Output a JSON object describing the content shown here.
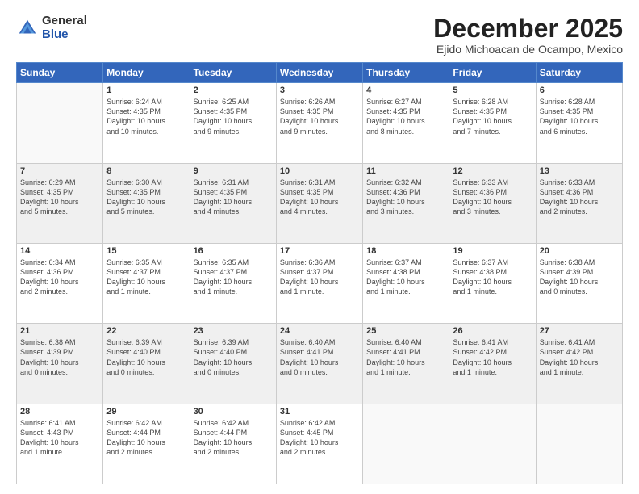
{
  "logo": {
    "general": "General",
    "blue": "Blue"
  },
  "title": "December 2025",
  "location": "Ejido Michoacan de Ocampo, Mexico",
  "weekdays": [
    "Sunday",
    "Monday",
    "Tuesday",
    "Wednesday",
    "Thursday",
    "Friday",
    "Saturday"
  ],
  "weeks": [
    [
      {
        "day": "",
        "info": ""
      },
      {
        "day": "1",
        "info": "Sunrise: 6:24 AM\nSunset: 4:35 PM\nDaylight: 10 hours\nand 10 minutes."
      },
      {
        "day": "2",
        "info": "Sunrise: 6:25 AM\nSunset: 4:35 PM\nDaylight: 10 hours\nand 9 minutes."
      },
      {
        "day": "3",
        "info": "Sunrise: 6:26 AM\nSunset: 4:35 PM\nDaylight: 10 hours\nand 9 minutes."
      },
      {
        "day": "4",
        "info": "Sunrise: 6:27 AM\nSunset: 4:35 PM\nDaylight: 10 hours\nand 8 minutes."
      },
      {
        "day": "5",
        "info": "Sunrise: 6:28 AM\nSunset: 4:35 PM\nDaylight: 10 hours\nand 7 minutes."
      },
      {
        "day": "6",
        "info": "Sunrise: 6:28 AM\nSunset: 4:35 PM\nDaylight: 10 hours\nand 6 minutes."
      }
    ],
    [
      {
        "day": "7",
        "info": "Sunrise: 6:29 AM\nSunset: 4:35 PM\nDaylight: 10 hours\nand 5 minutes."
      },
      {
        "day": "8",
        "info": "Sunrise: 6:30 AM\nSunset: 4:35 PM\nDaylight: 10 hours\nand 5 minutes."
      },
      {
        "day": "9",
        "info": "Sunrise: 6:31 AM\nSunset: 4:35 PM\nDaylight: 10 hours\nand 4 minutes."
      },
      {
        "day": "10",
        "info": "Sunrise: 6:31 AM\nSunset: 4:35 PM\nDaylight: 10 hours\nand 4 minutes."
      },
      {
        "day": "11",
        "info": "Sunrise: 6:32 AM\nSunset: 4:36 PM\nDaylight: 10 hours\nand 3 minutes."
      },
      {
        "day": "12",
        "info": "Sunrise: 6:33 AM\nSunset: 4:36 PM\nDaylight: 10 hours\nand 3 minutes."
      },
      {
        "day": "13",
        "info": "Sunrise: 6:33 AM\nSunset: 4:36 PM\nDaylight: 10 hours\nand 2 minutes."
      }
    ],
    [
      {
        "day": "14",
        "info": "Sunrise: 6:34 AM\nSunset: 4:36 PM\nDaylight: 10 hours\nand 2 minutes."
      },
      {
        "day": "15",
        "info": "Sunrise: 6:35 AM\nSunset: 4:37 PM\nDaylight: 10 hours\nand 1 minute."
      },
      {
        "day": "16",
        "info": "Sunrise: 6:35 AM\nSunset: 4:37 PM\nDaylight: 10 hours\nand 1 minute."
      },
      {
        "day": "17",
        "info": "Sunrise: 6:36 AM\nSunset: 4:37 PM\nDaylight: 10 hours\nand 1 minute."
      },
      {
        "day": "18",
        "info": "Sunrise: 6:37 AM\nSunset: 4:38 PM\nDaylight: 10 hours\nand 1 minute."
      },
      {
        "day": "19",
        "info": "Sunrise: 6:37 AM\nSunset: 4:38 PM\nDaylight: 10 hours\nand 1 minute."
      },
      {
        "day": "20",
        "info": "Sunrise: 6:38 AM\nSunset: 4:39 PM\nDaylight: 10 hours\nand 0 minutes."
      }
    ],
    [
      {
        "day": "21",
        "info": "Sunrise: 6:38 AM\nSunset: 4:39 PM\nDaylight: 10 hours\nand 0 minutes."
      },
      {
        "day": "22",
        "info": "Sunrise: 6:39 AM\nSunset: 4:40 PM\nDaylight: 10 hours\nand 0 minutes."
      },
      {
        "day": "23",
        "info": "Sunrise: 6:39 AM\nSunset: 4:40 PM\nDaylight: 10 hours\nand 0 minutes."
      },
      {
        "day": "24",
        "info": "Sunrise: 6:40 AM\nSunset: 4:41 PM\nDaylight: 10 hours\nand 0 minutes."
      },
      {
        "day": "25",
        "info": "Sunrise: 6:40 AM\nSunset: 4:41 PM\nDaylight: 10 hours\nand 1 minute."
      },
      {
        "day": "26",
        "info": "Sunrise: 6:41 AM\nSunset: 4:42 PM\nDaylight: 10 hours\nand 1 minute."
      },
      {
        "day": "27",
        "info": "Sunrise: 6:41 AM\nSunset: 4:42 PM\nDaylight: 10 hours\nand 1 minute."
      }
    ],
    [
      {
        "day": "28",
        "info": "Sunrise: 6:41 AM\nSunset: 4:43 PM\nDaylight: 10 hours\nand 1 minute."
      },
      {
        "day": "29",
        "info": "Sunrise: 6:42 AM\nSunset: 4:44 PM\nDaylight: 10 hours\nand 2 minutes."
      },
      {
        "day": "30",
        "info": "Sunrise: 6:42 AM\nSunset: 4:44 PM\nDaylight: 10 hours\nand 2 minutes."
      },
      {
        "day": "31",
        "info": "Sunrise: 6:42 AM\nSunset: 4:45 PM\nDaylight: 10 hours\nand 2 minutes."
      },
      {
        "day": "",
        "info": ""
      },
      {
        "day": "",
        "info": ""
      },
      {
        "day": "",
        "info": ""
      }
    ]
  ]
}
